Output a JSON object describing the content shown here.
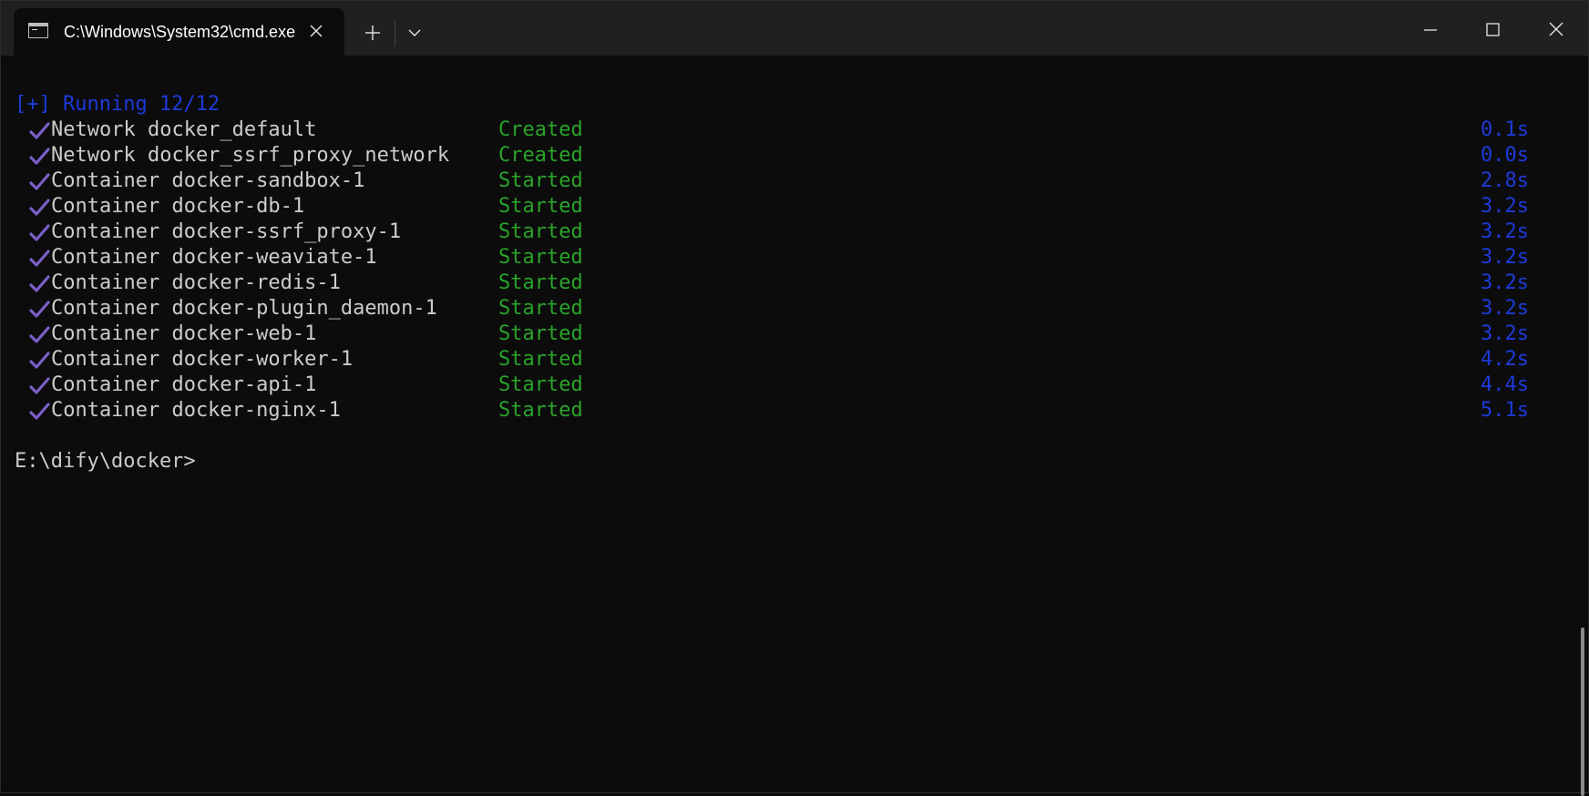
{
  "window": {
    "tab_title": "C:\\Windows\\System32\\cmd.exe",
    "icons": {
      "tab_icon": "console-icon",
      "close": "close-icon",
      "new_tab": "plus-icon",
      "dropdown": "chevron-down-icon",
      "minimize": "minimize-icon",
      "maximize": "maximize-icon",
      "window_close": "close-icon"
    }
  },
  "console": {
    "running_line": "[+] Running 12/12",
    "entries": [
      {
        "name": "Network docker_default",
        "status": "Created",
        "time": "0.1s"
      },
      {
        "name": "Network docker_ssrf_proxy_network",
        "status": "Created",
        "time": "0.0s"
      },
      {
        "name": "Container docker-sandbox-1",
        "status": "Started",
        "time": "2.8s"
      },
      {
        "name": "Container docker-db-1",
        "status": "Started",
        "time": "3.2s"
      },
      {
        "name": "Container docker-ssrf_proxy-1",
        "status": "Started",
        "time": "3.2s"
      },
      {
        "name": "Container docker-weaviate-1",
        "status": "Started",
        "time": "3.2s"
      },
      {
        "name": "Container docker-redis-1",
        "status": "Started",
        "time": "3.2s"
      },
      {
        "name": "Container docker-plugin_daemon-1",
        "status": "Started",
        "time": "3.2s"
      },
      {
        "name": "Container docker-web-1",
        "status": "Started",
        "time": "3.2s"
      },
      {
        "name": "Container docker-worker-1",
        "status": "Started",
        "time": "4.2s"
      },
      {
        "name": "Container docker-api-1",
        "status": "Started",
        "time": "4.4s"
      },
      {
        "name": "Container docker-nginx-1",
        "status": "Started",
        "time": "5.1s"
      }
    ],
    "prompt": "E:\\dify\\docker>"
  },
  "colors": {
    "background": "#0c0c0c",
    "titlebar": "#202020",
    "text": "#cccccc",
    "blue": "#1e3ad8",
    "green": "#2aa32a",
    "check": "#7b5fc7"
  }
}
